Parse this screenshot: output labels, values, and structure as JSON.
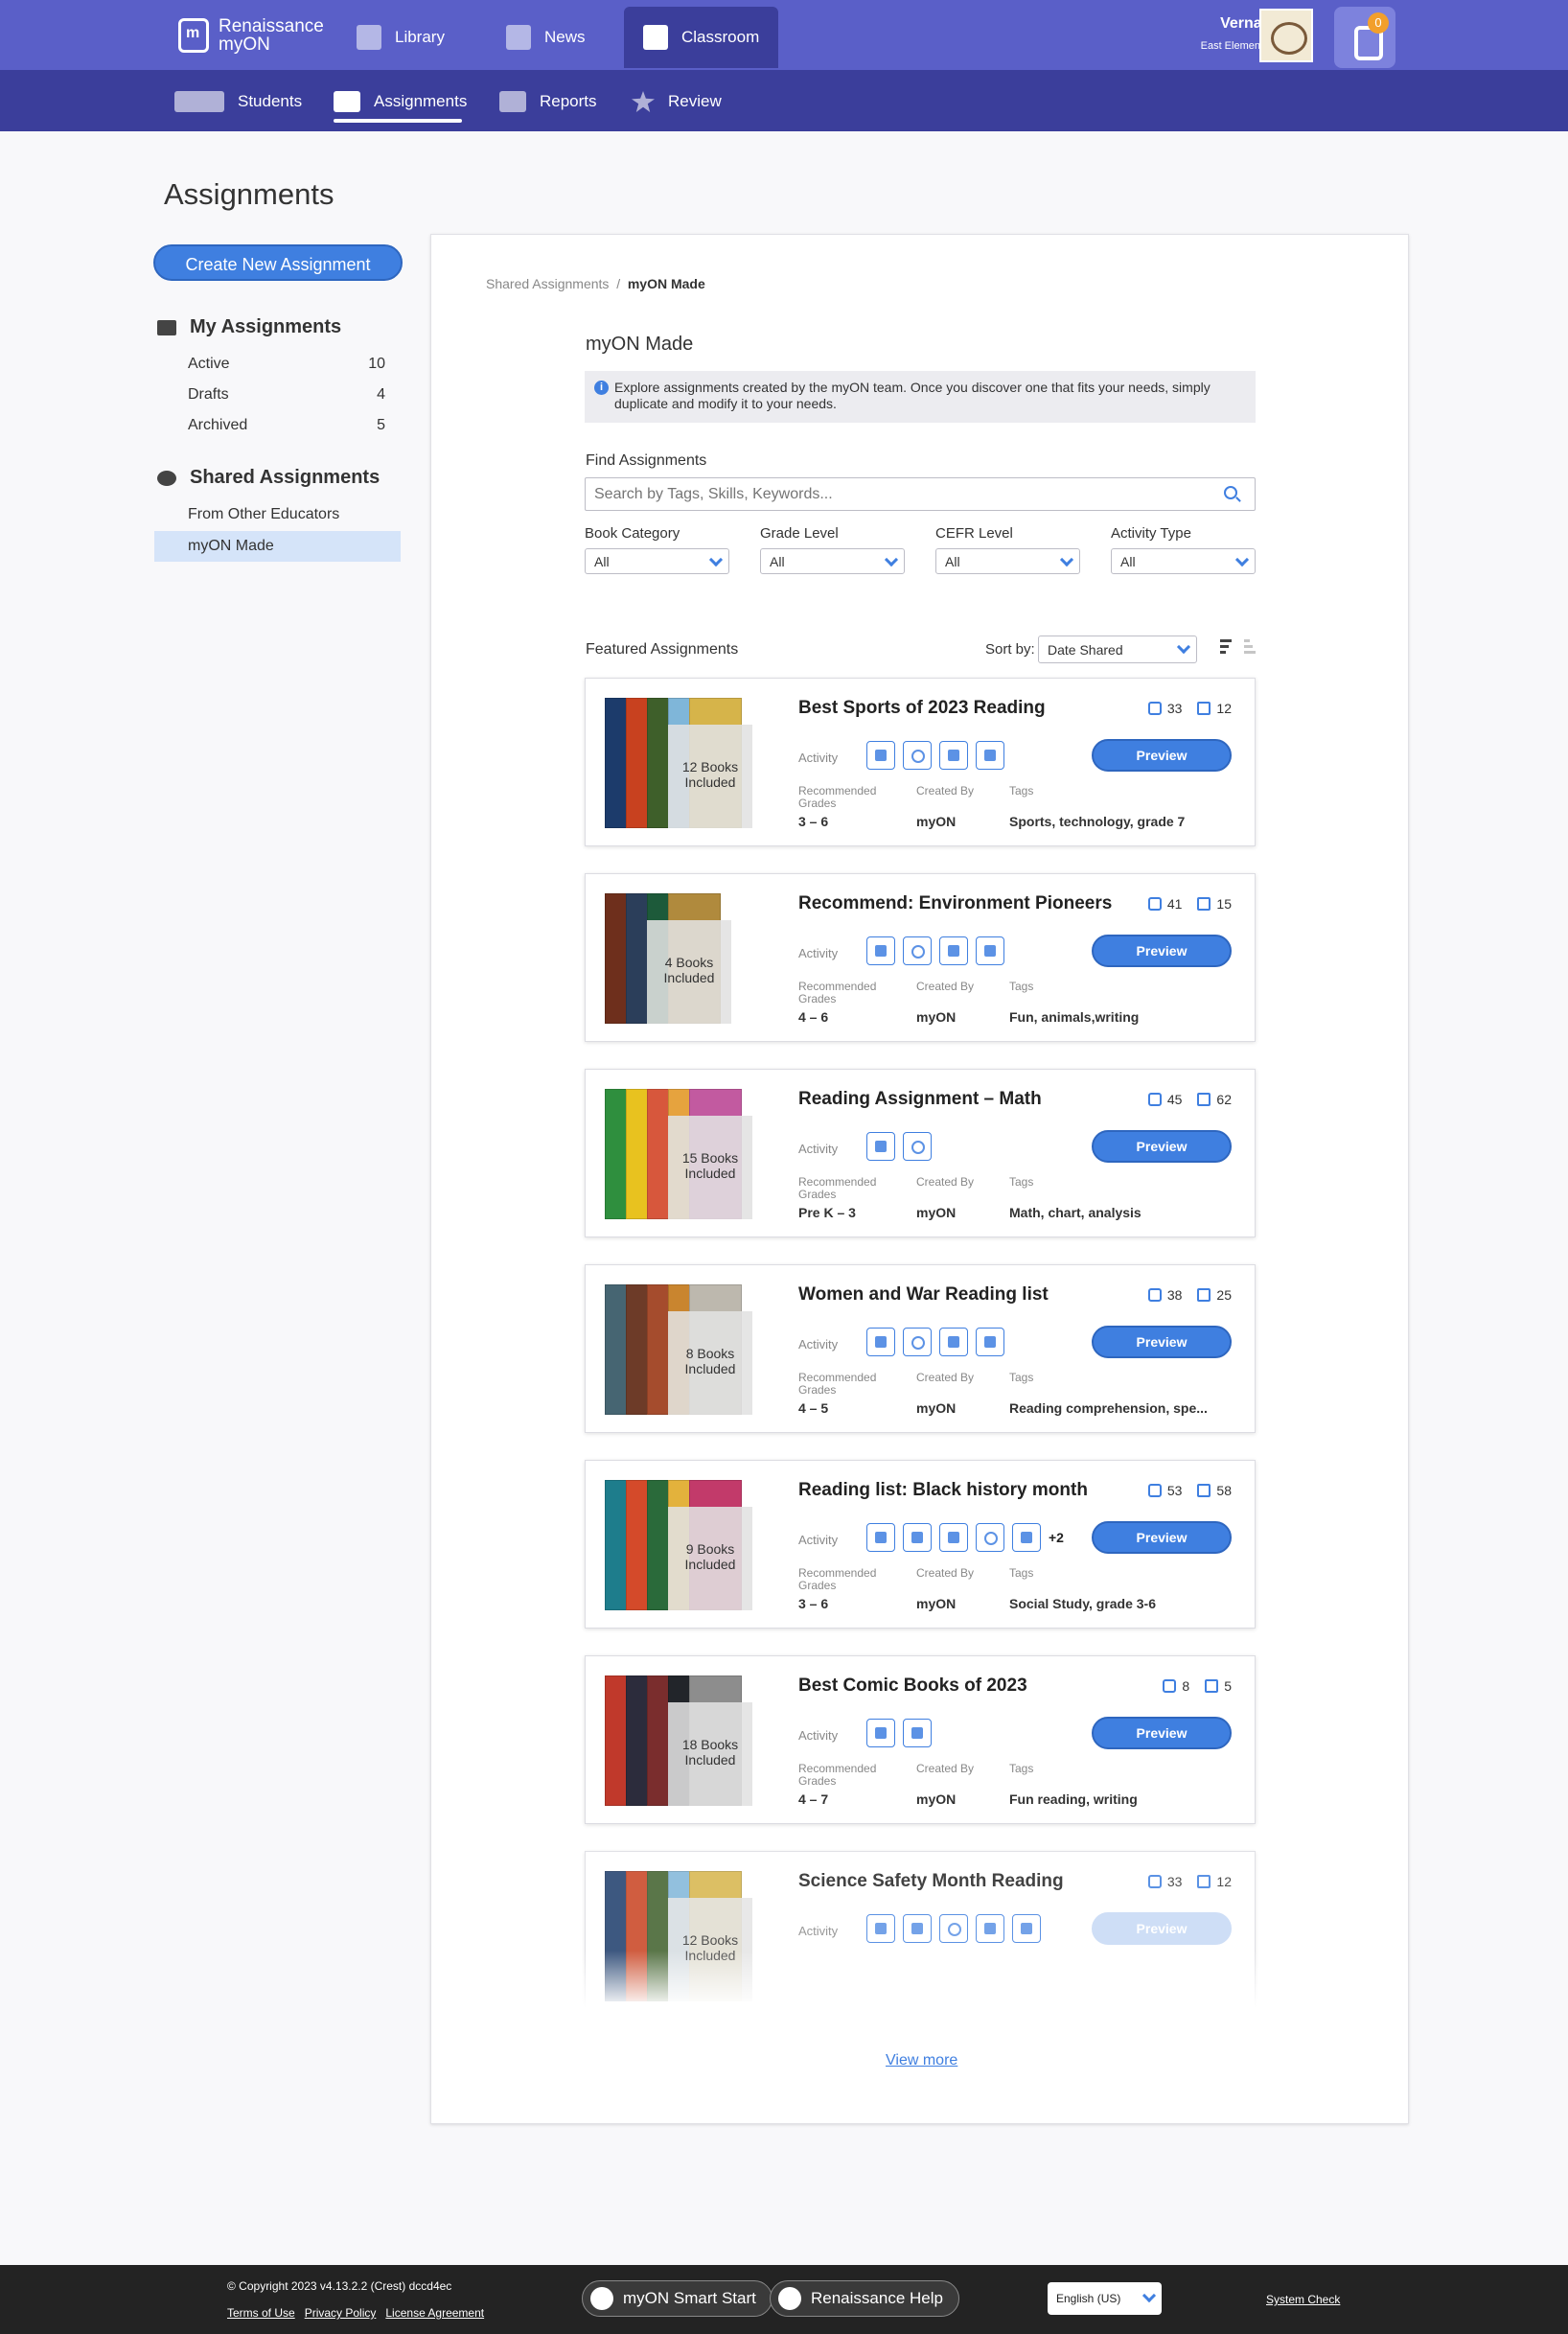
{
  "header": {
    "brand_line1": "Renaissance",
    "brand_line2": "myON",
    "nav": [
      {
        "label": "Library"
      },
      {
        "label": "News"
      },
      {
        "label": "Classroom"
      }
    ],
    "user_name": "Verna Morris",
    "user_school": "East Elementary School",
    "bag_count": "0"
  },
  "subnav": [
    {
      "label": "Students"
    },
    {
      "label": "Assignments"
    },
    {
      "label": "Reports"
    },
    {
      "label": "Review"
    }
  ],
  "page_title": "Assignments",
  "sidebar": {
    "create_label": "Create New Assignment",
    "my_title": "My Assignments",
    "my_items": [
      {
        "label": "Active",
        "count": "10"
      },
      {
        "label": "Drafts",
        "count": "4"
      },
      {
        "label": "Archived",
        "count": "5"
      }
    ],
    "shared_title": "Shared Assignments",
    "shared_items": [
      {
        "label": "From Other Educators"
      },
      {
        "label": "myON Made"
      }
    ]
  },
  "main": {
    "breadcrumb_parent": "Shared Assignments",
    "breadcrumb_sep": "/",
    "breadcrumb_current": "myON Made",
    "title": "myON Made",
    "info_text": "Explore assignments created by the myON team. Once you discover one that fits your needs, simply duplicate and modify it to your needs.",
    "find_label": "Find Assignments",
    "search_placeholder": "Search by Tags, Skills, Keywords...",
    "filters": [
      {
        "label": "Book Category",
        "value": "All"
      },
      {
        "label": "Grade Level",
        "value": "All"
      },
      {
        "label": "CEFR Level",
        "value": "All"
      },
      {
        "label": "Activity Type",
        "value": "All"
      }
    ],
    "featured_label": "Featured Assignments",
    "sort_label": "Sort by:",
    "sort_value": "Date Shared",
    "activity_label": "Activity",
    "grades_label": "Recommended Grades",
    "created_label": "Created By",
    "tags_label": "Tags",
    "preview_label": "Preview",
    "cards": [
      {
        "title": "Best Sports of 2023 Reading",
        "likes": "33",
        "copies": "12",
        "books": "12 Books Included",
        "grades": "3 – 6",
        "created_by": "myON",
        "tags": "Sports, technology, grade 7",
        "more": ""
      },
      {
        "title": "Recommend: Environment Pioneers",
        "likes": "41",
        "copies": "15",
        "books": "4 Books Included",
        "grades": "4 – 6",
        "created_by": "myON",
        "tags": "Fun, animals,writing",
        "more": ""
      },
      {
        "title": "Reading Assignment – Math",
        "likes": "45",
        "copies": "62",
        "books": "15 Books Included",
        "grades": "Pre K – 3",
        "created_by": "myON",
        "tags": "Math, chart, analysis",
        "more": ""
      },
      {
        "title": "Women and War Reading list",
        "likes": "38",
        "copies": "25",
        "books": "8 Books Included",
        "grades": "4 – 5",
        "created_by": "myON",
        "tags": "Reading comprehension, spe...",
        "more": ""
      },
      {
        "title": "Reading list: Black history month",
        "likes": "53",
        "copies": "58",
        "books": "9 Books Included",
        "grades": "3 – 6",
        "created_by": "myON",
        "tags": "Social Study, grade 3-6",
        "more": "+2"
      },
      {
        "title": "Best Comic Books of 2023",
        "likes": "8",
        "copies": "5",
        "books": "18 Books Included",
        "grades": "4 – 7",
        "created_by": "myON",
        "tags": "Fun reading, writing",
        "more": ""
      },
      {
        "title": "Science Safety Month Reading",
        "likes": "33",
        "copies": "12",
        "books": "12 Books Included",
        "grades": "",
        "created_by": "",
        "tags": "",
        "more": ""
      }
    ],
    "view_more": "View more"
  },
  "footer": {
    "copyright": "© Copyright 2023 v4.13.2.2 (Crest) dccd4ec",
    "terms": "Terms of Use",
    "privacy": "Privacy Policy",
    "license": "License Agreement",
    "smart_start": "myON Smart Start",
    "help": "Renaissance Help",
    "language": "English (US)",
    "system_check": "System Check"
  }
}
